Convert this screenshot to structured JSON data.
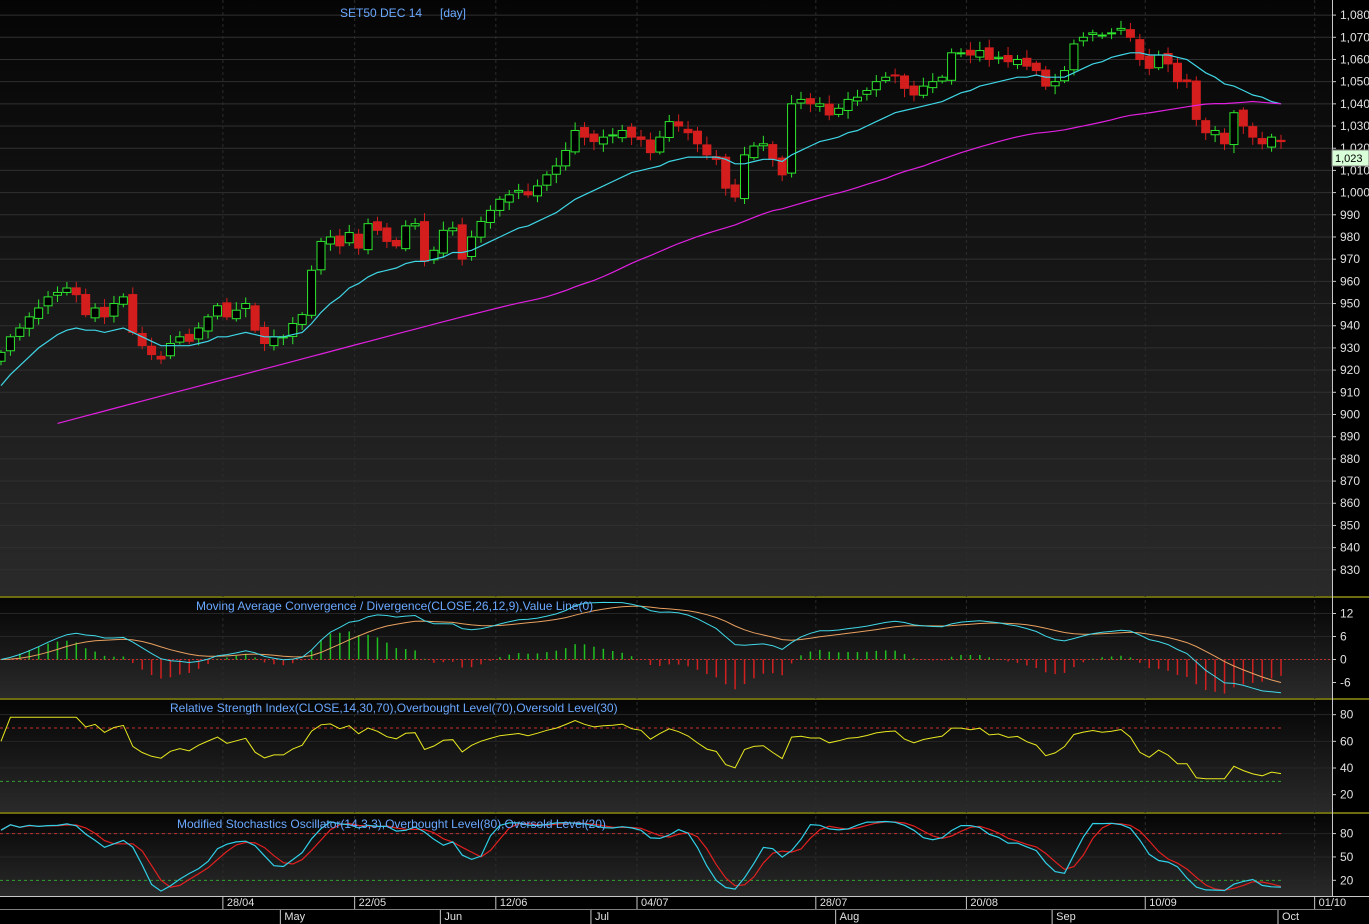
{
  "header": {
    "title": "SET50 DEC 14",
    "interval": "[day]"
  },
  "last_price_label": "1,023",
  "x_axis": {
    "top_labels": [
      "28/04",
      "22/05",
      "12/06",
      "04/07",
      "28/07",
      "20/08",
      "10/09",
      "01/10"
    ],
    "month_labels": [
      "May",
      "Jun",
      "Jul",
      "Aug",
      "Sep",
      "Oct"
    ]
  },
  "colors": {
    "up_candle": "#2ee62e",
    "down_candle": "#d41e1e",
    "ema_fast": "#3fd6e6",
    "ema_slow": "#e020e0",
    "macd": "#40d8e8",
    "macd_signal": "#e8a060",
    "rsi": "#e8e820",
    "stoch_k": "#30d0e8",
    "stoch_d": "#e02020",
    "overbought": "#c03030",
    "oversold": "#30a030",
    "panel_title": "#6aa8ff"
  },
  "chart_data": [
    {
      "type": "candlestick",
      "title": "SET50 DEC 14   [day]",
      "ylim": [
        820,
        1085
      ],
      "y_ticks": [
        830,
        840,
        850,
        860,
        870,
        880,
        890,
        900,
        910,
        920,
        930,
        940,
        950,
        960,
        970,
        980,
        990,
        1000,
        1010,
        1020,
        1030,
        1040,
        1050,
        1060,
        1070,
        1080
      ],
      "y_tick_labels": [
        "830",
        "840",
        "850",
        "860",
        "870",
        "880",
        "890",
        "900",
        "910",
        "920",
        "930",
        "940",
        "950",
        "960",
        "970",
        "980",
        "990",
        "1,000",
        "1,010",
        "1,020",
        "1,030",
        "1,040",
        "1,050",
        "1,060",
        "1,070",
        "1,080"
      ],
      "close": [
        928,
        935,
        939,
        944,
        948,
        953,
        955,
        957,
        954,
        945,
        948,
        944,
        950,
        953,
        937,
        931,
        927,
        925,
        932,
        935,
        933,
        939,
        944,
        949,
        944,
        947,
        950,
        938,
        932,
        935,
        935,
        941,
        945,
        965,
        978,
        980,
        976,
        982,
        975,
        986,
        983,
        978,
        976,
        985,
        986,
        969,
        974,
        983,
        984,
        970,
        980,
        987,
        992,
        997,
        999,
        1001,
        999,
        1003,
        1008,
        1012,
        1019,
        1028,
        1025,
        1023,
        1025,
        1026,
        1028,
        1025,
        1024,
        1018,
        1025,
        1032,
        1030,
        1027,
        1022,
        1017,
        1015,
        1002,
        998,
        1017,
        1021,
        1022,
        1015,
        1008,
        1040,
        1042,
        1040,
        1040,
        1035,
        1038,
        1042,
        1043,
        1046,
        1050,
        1052,
        1053,
        1047,
        1044,
        1048,
        1050,
        1052,
        1063,
        1063,
        1062,
        1064,
        1060,
        1061,
        1059,
        1060,
        1057,
        1055,
        1048,
        1050,
        1055,
        1067,
        1070,
        1072,
        1071,
        1072,
        1074,
        1070,
        1060,
        1056,
        1062,
        1058,
        1050,
        1050,
        1033,
        1027,
        1028,
        1022,
        1036,
        1030,
        1025,
        1022,
        1025,
        1023
      ],
      "ema_fast": [
        913,
        918,
        922,
        926,
        930,
        933,
        936,
        938,
        939,
        938,
        938,
        937,
        938,
        939,
        937,
        935,
        933,
        931,
        931,
        931,
        931,
        932,
        933,
        935,
        935,
        936,
        937,
        936,
        935,
        935,
        935,
        936,
        937,
        941,
        946,
        950,
        953,
        957,
        959,
        962,
        964,
        965,
        966,
        968,
        969,
        969,
        970,
        971,
        973,
        973,
        974,
        976,
        978,
        980,
        982,
        984,
        985,
        987,
        989,
        991,
        994,
        997,
        999,
        1001,
        1003,
        1005,
        1007,
        1009,
        1010,
        1011,
        1012,
        1014,
        1015,
        1016,
        1016,
        1016,
        1016,
        1015,
        1013,
        1013,
        1014,
        1015,
        1015,
        1014,
        1017,
        1019,
        1021,
        1023,
        1024,
        1025,
        1027,
        1028,
        1030,
        1032,
        1034,
        1036,
        1037,
        1038,
        1039,
        1040,
        1041,
        1043,
        1045,
        1046,
        1048,
        1049,
        1050,
        1051,
        1052,
        1052,
        1053,
        1052,
        1052,
        1052,
        1054,
        1056,
        1058,
        1059,
        1061,
        1062,
        1063,
        1063,
        1062,
        1062,
        1062,
        1061,
        1060,
        1057,
        1054,
        1052,
        1049,
        1048,
        1046,
        1044,
        1043,
        1041,
        1040
      ],
      "ema_slow": [
        null,
        null,
        null,
        null,
        null,
        null,
        null,
        null,
        null,
        null,
        null,
        null,
        null,
        null,
        null,
        null,
        null,
        null,
        null,
        null,
        null,
        null,
        null,
        null,
        null,
        null,
        null,
        null,
        null,
        null,
        null,
        null,
        null,
        null,
        null,
        null,
        null,
        null,
        null,
        null,
        null,
        null,
        null,
        null,
        null,
        null,
        null,
        null,
        null,
        null,
        null,
        null,
        null,
        null,
        null,
        null,
        null,
        null,
        null,
        null,
        null,
        null,
        null,
        null,
        null,
        null,
        null,
        null,
        null,
        null,
        null,
        null,
        null,
        null,
        null,
        null,
        null,
        null,
        null,
        null,
        null,
        null,
        null,
        null,
        null,
        null,
        null,
        null,
        null,
        null,
        null,
        null,
        null,
        null,
        null,
        null,
        null,
        null,
        null,
        null,
        null,
        null,
        null,
        null,
        null,
        null,
        null,
        null,
        null,
        null,
        null,
        null,
        null,
        null,
        null,
        null,
        null,
        null,
        null,
        null,
        null,
        null,
        null,
        null,
        null,
        null,
        null,
        null,
        null,
        null,
        null,
        null,
        null,
        null,
        null,
        null,
        null,
        null
      ]
    },
    {
      "type": "line",
      "title": "Moving Average Convergence / Divergence(CLOSE,26,12,9),Value Line(0)",
      "ylim": [
        -9,
        15
      ],
      "y_ticks": [
        -6,
        0,
        6,
        12
      ],
      "y_tick_labels": [
        "-6",
        "0",
        "6",
        "12"
      ]
    },
    {
      "type": "line",
      "title": "Relative Strength Index(CLOSE,14,30,70),Overbought Level(70),Oversold Level(30)",
      "ylim": [
        10,
        88
      ],
      "y_ticks": [
        20,
        40,
        60,
        80
      ],
      "y_tick_labels": [
        "20",
        "40",
        "60",
        "80"
      ],
      "levels": [
        70,
        30
      ]
    },
    {
      "type": "line",
      "title": "Modified Stochastics Oscillator(14,3,3),Overbought Level(80),Oversold Level(20)",
      "ylim": [
        5,
        100
      ],
      "y_ticks": [
        20,
        50,
        80
      ],
      "y_tick_labels": [
        "20",
        "50",
        "80"
      ],
      "levels": [
        80,
        20
      ]
    }
  ]
}
